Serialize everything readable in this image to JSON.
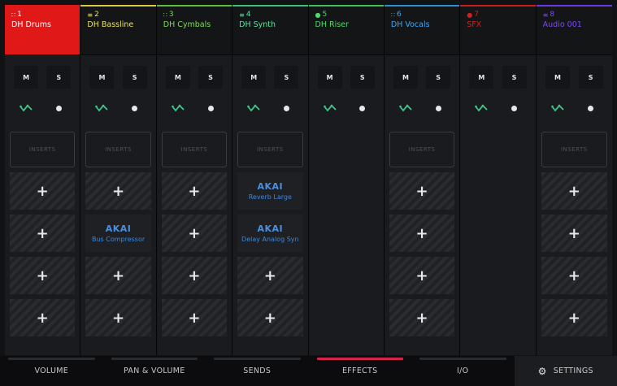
{
  "channels": [
    {
      "num": "1",
      "name": "DH Drums",
      "accent": "#e01818",
      "text_color": "#ffffff",
      "type": "drum",
      "selected": true,
      "has_ms": true,
      "has_inserts": true,
      "inserts_label": "INSERTS",
      "slots": [
        "+",
        "+",
        "+",
        "+"
      ]
    },
    {
      "num": "2",
      "name": "DH Bassline",
      "accent": "#d8c844",
      "text_color": "#e8e05a",
      "type": "keys",
      "selected": false,
      "has_ms": true,
      "has_inserts": true,
      "inserts_label": "INSERTS",
      "slots": [
        "+",
        {
          "brand": "AKAI",
          "name": "Bus Compressor"
        },
        "+",
        "+"
      ]
    },
    {
      "num": "3",
      "name": "DH Cymbals",
      "accent": "#5fbf3a",
      "text_color": "#7ed957",
      "type": "drum",
      "selected": false,
      "has_ms": true,
      "has_inserts": true,
      "inserts_label": "INSERTS",
      "slots": [
        "+",
        "+",
        "+",
        "+"
      ]
    },
    {
      "num": "4",
      "name": "DH Synth",
      "accent": "#3fbf7a",
      "text_color": "#5fe0a0",
      "type": "keys",
      "selected": false,
      "has_ms": true,
      "has_inserts": true,
      "inserts_label": "INSERTS",
      "slots": [
        {
          "brand": "AKAI",
          "name": "Reverb Large"
        },
        {
          "brand": "AKAI",
          "name": "Delay Analog Syn"
        },
        "+",
        "+"
      ]
    },
    {
      "num": "5",
      "name": "DH Riser",
      "accent": "#3fbf5a",
      "text_color": "#4fd96a",
      "type": "audio",
      "selected": false,
      "has_ms": true,
      "has_inserts": false,
      "inserts_label": "",
      "slots": []
    },
    {
      "num": "6",
      "name": "DH Vocals",
      "accent": "#2f8fd0",
      "text_color": "#3fa8f0",
      "type": "drum",
      "selected": false,
      "has_ms": true,
      "has_inserts": true,
      "inserts_label": "INSERTS",
      "slots": [
        "+",
        "+",
        "+",
        "+"
      ]
    },
    {
      "num": "7",
      "name": "SFX",
      "accent": "#c81e1e",
      "text_color": "#d02020",
      "type": "audio",
      "selected": false,
      "has_ms": true,
      "has_inserts": false,
      "inserts_label": "",
      "slots": []
    },
    {
      "num": "8",
      "name": "Audio 001",
      "accent": "#6a3adf",
      "text_color": "#7a4af0",
      "type": "keys",
      "selected": false,
      "has_ms": true,
      "has_inserts": true,
      "inserts_label": "INSERTS",
      "slots": [
        "+",
        "+",
        "+",
        "+"
      ]
    }
  ],
  "ms_labels": {
    "mute": "M",
    "solo": "S"
  },
  "tabs": [
    {
      "label": "VOLUME",
      "active": false
    },
    {
      "label": "PAN & VOLUME",
      "active": false
    },
    {
      "label": "SENDS",
      "active": false
    },
    {
      "label": "EFFECTS",
      "active": true
    },
    {
      "label": "I/O",
      "active": false
    }
  ],
  "settings_label": "SETTINGS"
}
